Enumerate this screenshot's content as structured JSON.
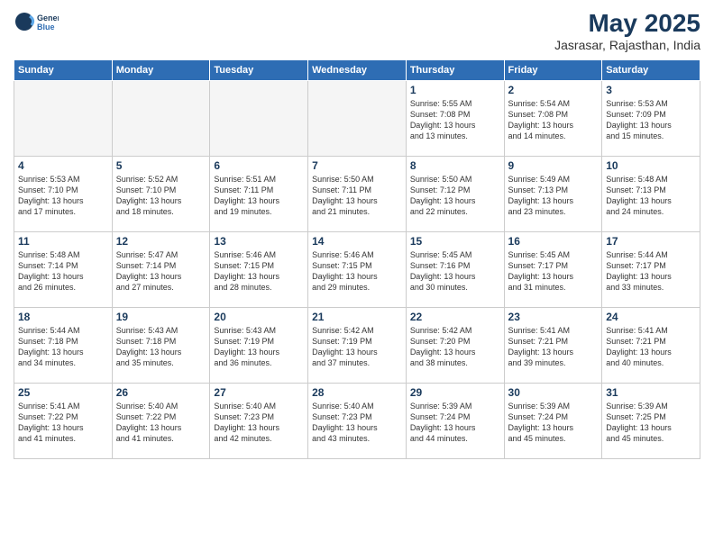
{
  "header": {
    "logo_line1": "General",
    "logo_line2": "Blue",
    "month": "May 2025",
    "location": "Jasrasar, Rajasthan, India"
  },
  "weekdays": [
    "Sunday",
    "Monday",
    "Tuesday",
    "Wednesday",
    "Thursday",
    "Friday",
    "Saturday"
  ],
  "weeks": [
    [
      {
        "day": "",
        "info": ""
      },
      {
        "day": "",
        "info": ""
      },
      {
        "day": "",
        "info": ""
      },
      {
        "day": "",
        "info": ""
      },
      {
        "day": "1",
        "info": "Sunrise: 5:55 AM\nSunset: 7:08 PM\nDaylight: 13 hours\nand 13 minutes."
      },
      {
        "day": "2",
        "info": "Sunrise: 5:54 AM\nSunset: 7:08 PM\nDaylight: 13 hours\nand 14 minutes."
      },
      {
        "day": "3",
        "info": "Sunrise: 5:53 AM\nSunset: 7:09 PM\nDaylight: 13 hours\nand 15 minutes."
      }
    ],
    [
      {
        "day": "4",
        "info": "Sunrise: 5:53 AM\nSunset: 7:10 PM\nDaylight: 13 hours\nand 17 minutes."
      },
      {
        "day": "5",
        "info": "Sunrise: 5:52 AM\nSunset: 7:10 PM\nDaylight: 13 hours\nand 18 minutes."
      },
      {
        "day": "6",
        "info": "Sunrise: 5:51 AM\nSunset: 7:11 PM\nDaylight: 13 hours\nand 19 minutes."
      },
      {
        "day": "7",
        "info": "Sunrise: 5:50 AM\nSunset: 7:11 PM\nDaylight: 13 hours\nand 21 minutes."
      },
      {
        "day": "8",
        "info": "Sunrise: 5:50 AM\nSunset: 7:12 PM\nDaylight: 13 hours\nand 22 minutes."
      },
      {
        "day": "9",
        "info": "Sunrise: 5:49 AM\nSunset: 7:13 PM\nDaylight: 13 hours\nand 23 minutes."
      },
      {
        "day": "10",
        "info": "Sunrise: 5:48 AM\nSunset: 7:13 PM\nDaylight: 13 hours\nand 24 minutes."
      }
    ],
    [
      {
        "day": "11",
        "info": "Sunrise: 5:48 AM\nSunset: 7:14 PM\nDaylight: 13 hours\nand 26 minutes."
      },
      {
        "day": "12",
        "info": "Sunrise: 5:47 AM\nSunset: 7:14 PM\nDaylight: 13 hours\nand 27 minutes."
      },
      {
        "day": "13",
        "info": "Sunrise: 5:46 AM\nSunset: 7:15 PM\nDaylight: 13 hours\nand 28 minutes."
      },
      {
        "day": "14",
        "info": "Sunrise: 5:46 AM\nSunset: 7:15 PM\nDaylight: 13 hours\nand 29 minutes."
      },
      {
        "day": "15",
        "info": "Sunrise: 5:45 AM\nSunset: 7:16 PM\nDaylight: 13 hours\nand 30 minutes."
      },
      {
        "day": "16",
        "info": "Sunrise: 5:45 AM\nSunset: 7:17 PM\nDaylight: 13 hours\nand 31 minutes."
      },
      {
        "day": "17",
        "info": "Sunrise: 5:44 AM\nSunset: 7:17 PM\nDaylight: 13 hours\nand 33 minutes."
      }
    ],
    [
      {
        "day": "18",
        "info": "Sunrise: 5:44 AM\nSunset: 7:18 PM\nDaylight: 13 hours\nand 34 minutes."
      },
      {
        "day": "19",
        "info": "Sunrise: 5:43 AM\nSunset: 7:18 PM\nDaylight: 13 hours\nand 35 minutes."
      },
      {
        "day": "20",
        "info": "Sunrise: 5:43 AM\nSunset: 7:19 PM\nDaylight: 13 hours\nand 36 minutes."
      },
      {
        "day": "21",
        "info": "Sunrise: 5:42 AM\nSunset: 7:19 PM\nDaylight: 13 hours\nand 37 minutes."
      },
      {
        "day": "22",
        "info": "Sunrise: 5:42 AM\nSunset: 7:20 PM\nDaylight: 13 hours\nand 38 minutes."
      },
      {
        "day": "23",
        "info": "Sunrise: 5:41 AM\nSunset: 7:21 PM\nDaylight: 13 hours\nand 39 minutes."
      },
      {
        "day": "24",
        "info": "Sunrise: 5:41 AM\nSunset: 7:21 PM\nDaylight: 13 hours\nand 40 minutes."
      }
    ],
    [
      {
        "day": "25",
        "info": "Sunrise: 5:41 AM\nSunset: 7:22 PM\nDaylight: 13 hours\nand 41 minutes."
      },
      {
        "day": "26",
        "info": "Sunrise: 5:40 AM\nSunset: 7:22 PM\nDaylight: 13 hours\nand 41 minutes."
      },
      {
        "day": "27",
        "info": "Sunrise: 5:40 AM\nSunset: 7:23 PM\nDaylight: 13 hours\nand 42 minutes."
      },
      {
        "day": "28",
        "info": "Sunrise: 5:40 AM\nSunset: 7:23 PM\nDaylight: 13 hours\nand 43 minutes."
      },
      {
        "day": "29",
        "info": "Sunrise: 5:39 AM\nSunset: 7:24 PM\nDaylight: 13 hours\nand 44 minutes."
      },
      {
        "day": "30",
        "info": "Sunrise: 5:39 AM\nSunset: 7:24 PM\nDaylight: 13 hours\nand 45 minutes."
      },
      {
        "day": "31",
        "info": "Sunrise: 5:39 AM\nSunset: 7:25 PM\nDaylight: 13 hours\nand 45 minutes."
      }
    ]
  ]
}
